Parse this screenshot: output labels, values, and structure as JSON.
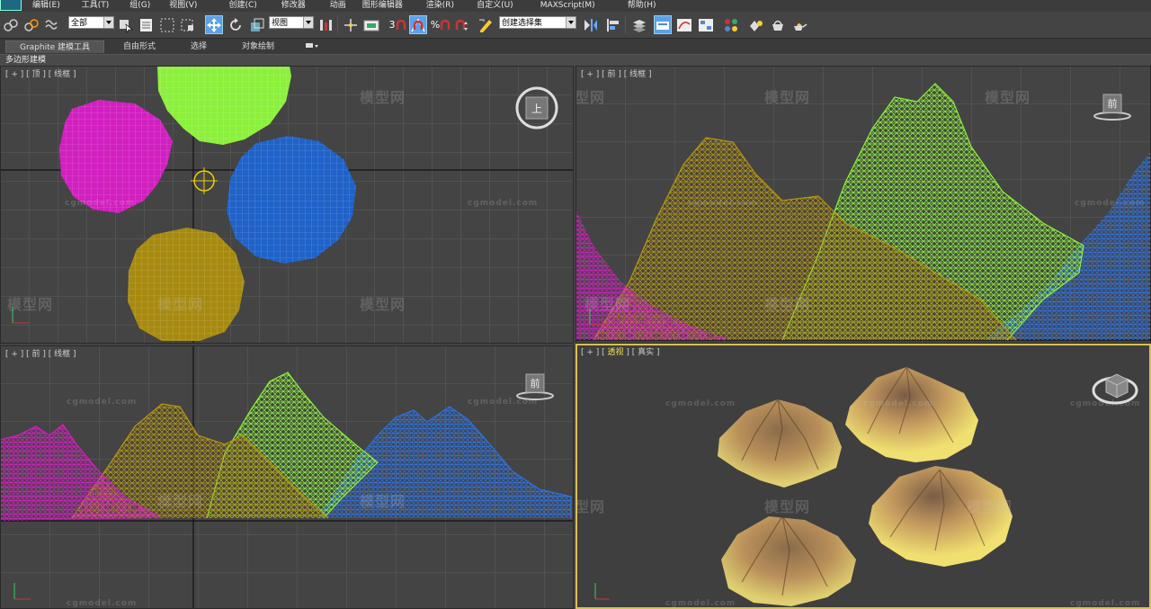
{
  "menubar": {
    "items": [
      "编辑(E)",
      "工具(T)",
      "组(G)",
      "视图(V)",
      "创建(C)",
      "修改器",
      "动画",
      "图形编辑器",
      "渲染(R)",
      "自定义(U)",
      "MAXScript(M)",
      "帮助(H)"
    ]
  },
  "toolbar": {
    "selection_filter": "全部",
    "ref_coord": "视图",
    "named_selection": "创建选择集",
    "snap_label": "3",
    "snap_angle": "%"
  },
  "ribbon": {
    "tabs": [
      "Graphite 建模工具",
      "自由形式",
      "选择",
      "对象绘制"
    ],
    "subtitle": "多边形建模"
  },
  "viewports": {
    "top": {
      "label": "[ + ] [ 顶 ] [ 线框 ]",
      "cube_face": "上"
    },
    "front": {
      "label": "[ + ] [ 前 ] [ 线框 ]",
      "cube_face": "前"
    },
    "left": {
      "label": "[ + ] [ 前 ] [ 线框 ]",
      "cube_face": "前"
    },
    "perspective": {
      "label_pre": "[ + ] [ ",
      "label_view": "透视",
      "label_post": " ] [ 真实 ]"
    }
  },
  "watermark": {
    "logo": "模型网",
    "url": "cgmodel.com"
  },
  "colors": {
    "magenta": "#d21fc0",
    "green": "#8cf03c",
    "blue": "#1f62c8",
    "gold": "#a68a10",
    "viewport_bg": "#444444",
    "active_border": "#d8c050"
  }
}
